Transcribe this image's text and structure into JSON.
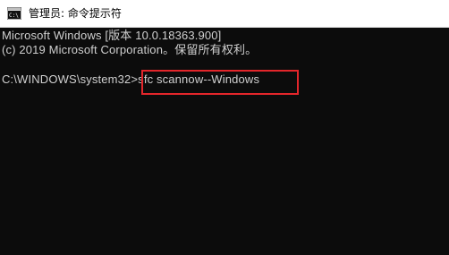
{
  "window": {
    "title": "管理员: 命令提示符",
    "icon": "console-app-icon"
  },
  "console": {
    "lines": [
      "Microsoft Windows [版本 10.0.18363.900]",
      "(c) 2019 Microsoft Corporation。保留所有权利。"
    ],
    "prompt": "C:\\WINDOWS\\system32>",
    "command": "sfc scannow--Windows",
    "highlight_color": "#e3262b",
    "background_color": "#0c0c0c",
    "text_color": "#d0d0d0"
  }
}
